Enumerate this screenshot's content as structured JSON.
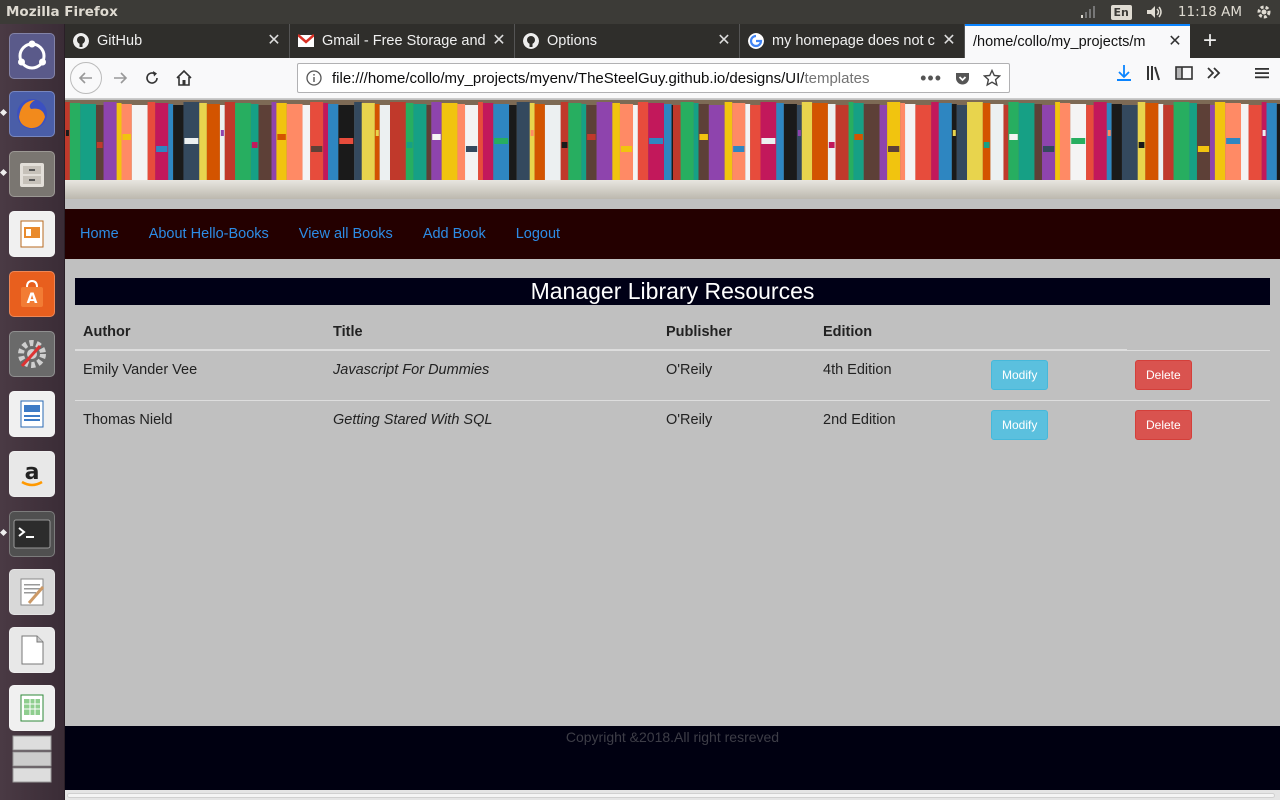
{
  "os": {
    "app_title": "Mozilla Firefox",
    "language": "En",
    "clock": "11:18 AM"
  },
  "browser": {
    "tabs": [
      {
        "label": "GitHub",
        "icon": "github-icon"
      },
      {
        "label": "Gmail - Free Storage and",
        "icon": "gmail-icon"
      },
      {
        "label": "Options",
        "icon": "github-icon"
      },
      {
        "label": "my homepage does not c",
        "icon": "google-icon"
      },
      {
        "label": "/home/collo/my_projects/m",
        "icon": "none",
        "active": true
      }
    ],
    "url_main": "file:///home/collo/my_projects/myenv/TheSteelGuy.github.io/designs/UI/",
    "url_dim": "templates",
    "accent": "#0a84ff"
  },
  "site": {
    "nav": [
      "Home",
      "About Hello-Books",
      "View all Books",
      "Add Book",
      "Logout"
    ],
    "heading": "Manager Library Resources",
    "table": {
      "headers": [
        "Author",
        "Title",
        "Publisher",
        "Edition"
      ],
      "rows": [
        {
          "author": "Emily Vander Vee",
          "title": "Javascript For Dummies",
          "publisher": "O'Reily",
          "edition": "4th Edition",
          "modify": "Modify",
          "delete": "Delete"
        },
        {
          "author": "Thomas Nield",
          "title": "Getting Stared With SQL",
          "publisher": "O'Reily",
          "edition": "2nd Edition",
          "modify": "Modify",
          "delete": "Delete"
        }
      ]
    },
    "footer": "Copyright &2018.All right resreved",
    "colors": {
      "nav_bg": "#240000",
      "link": "#2d8ce6",
      "heading_bg": "#000016",
      "modify": "#5bc0de",
      "delete": "#d9534f",
      "footer_bg": "#000011"
    }
  }
}
